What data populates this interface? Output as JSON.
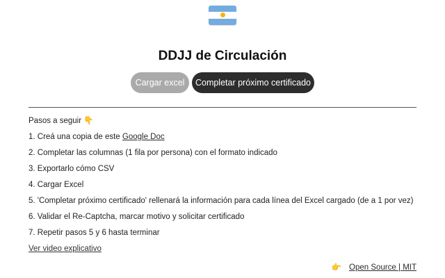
{
  "header": {
    "flag_icon": "argentina-flag-icon",
    "flag_colors": {
      "blue": "#74acdf",
      "white": "#ffffff",
      "sun": "#f6b40e"
    },
    "title": "DDJJ de Circulación"
  },
  "buttons": {
    "load_excel": {
      "label": "Cargar excel",
      "state": "disabled",
      "color": "#aaaaaa"
    },
    "next_certificate": {
      "label": "Completar próximo certificado",
      "color": "#2d2d2d"
    }
  },
  "steps": {
    "heading": "Pasos a seguir",
    "heading_icon": "👇",
    "items": [
      {
        "before": "1. Creá una copia de este ",
        "link": "Google Doc"
      },
      {
        "text": "2. Completar las columnas (1 fila por persona) con el formato indicado"
      },
      {
        "text": "3. Exportarlo cómo CSV"
      },
      {
        "text": "4. Cargar Excel"
      },
      {
        "text": "5. 'Completar próximo certificado' rellenará la información para cada línea del Excel cargado (de a 1 por vez)"
      },
      {
        "text": "6. Validar el Re-Captcha, marcar motivo y solicitar certificado"
      },
      {
        "text": "7. Repetir pasos 5 y 6 hasta terminar"
      }
    ],
    "video_link": "Ver video explicativo"
  },
  "footer": {
    "hand_icon": "👉",
    "link": "Open Source | MIT"
  }
}
